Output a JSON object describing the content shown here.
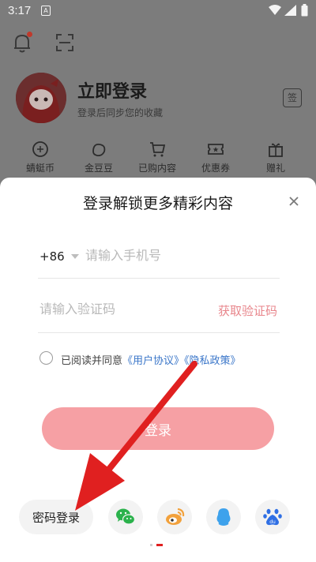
{
  "status_bar": {
    "time": "3:17",
    "notice_glyph": "A"
  },
  "background_page": {
    "title": "立即登录",
    "subtitle": "登录后同步您的收藏",
    "sign_icon_text": "签",
    "quick_items": [
      "蜻蜓币",
      "金豆豆",
      "已购内容",
      "优惠券",
      "赠礼"
    ]
  },
  "login_sheet": {
    "title": "登录解锁更多精彩内容",
    "country_code": "+86",
    "phone_placeholder": "请输入手机号",
    "code_placeholder": "请输入验证码",
    "get_code": "获取验证码",
    "agree_prefix": "已阅读并同意",
    "user_agreement": "《用户协议》",
    "privacy_policy": "《隐私政策》",
    "login_button": "登录",
    "password_login": "密码登录",
    "social_icons": [
      "wechat-icon",
      "weibo-icon",
      "qq-icon",
      "baidu-icon"
    ]
  },
  "colors": {
    "accent_pink": "#f6a0a4",
    "link_blue": "#3a76c9",
    "get_code_pink": "#e8868c",
    "arrow_red": "#e02020",
    "wechat_green": "#2bb24c",
    "weibo_orange": "#f2a13c",
    "qq_blue": "#3ea2ec",
    "baidu_blue": "#2f6fe4"
  }
}
